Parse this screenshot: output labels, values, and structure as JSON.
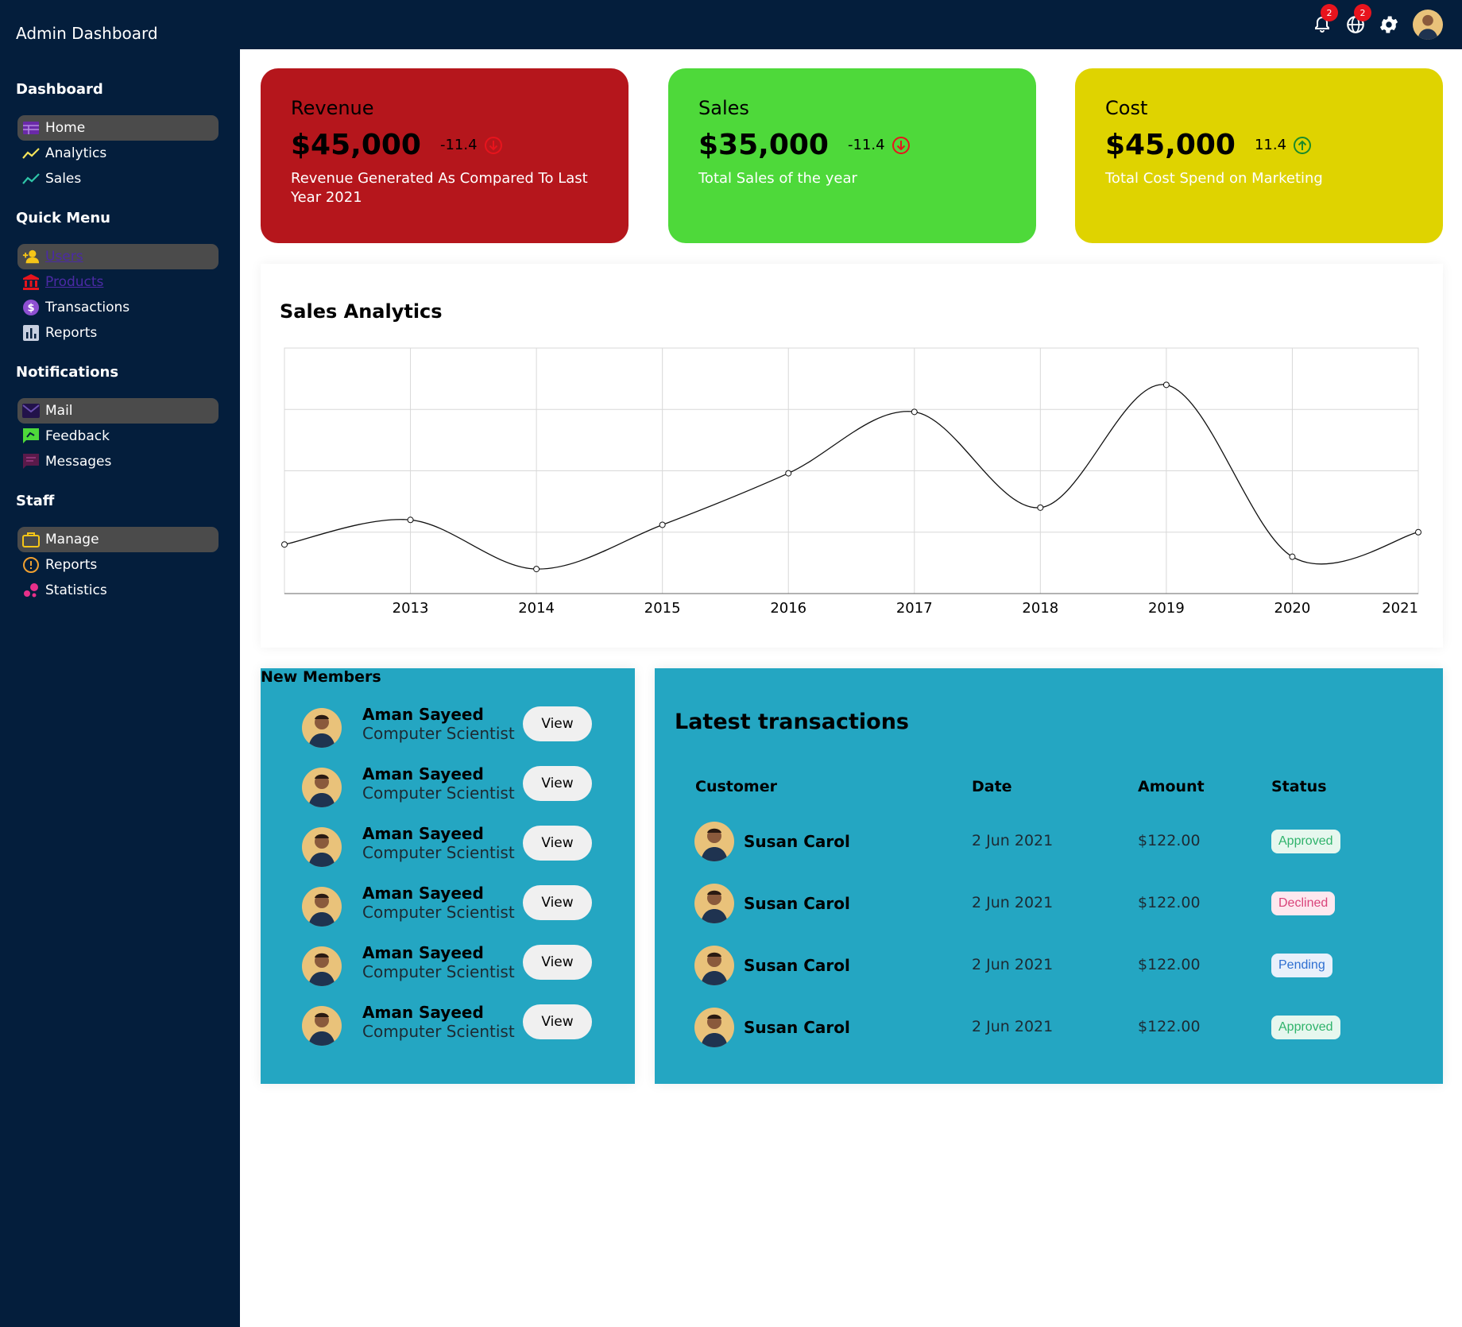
{
  "app": {
    "title": "Admin Dashboard"
  },
  "topbar": {
    "notifications": {
      "icon": "bell-icon",
      "badge": "2"
    },
    "language": {
      "icon": "globe-icon",
      "badge": "2"
    },
    "settings": {
      "icon": "gear-icon"
    },
    "avatar": {
      "icon": "avatar"
    }
  },
  "sidebar": {
    "sections": [
      {
        "title": "Dashboard",
        "items": [
          {
            "label": "Home",
            "icon": "home-icon",
            "active": true
          },
          {
            "label": "Analytics",
            "icon": "trending-up-icon"
          },
          {
            "label": "Sales",
            "icon": "trending-up-icon"
          }
        ]
      },
      {
        "title": "Quick Menu",
        "items": [
          {
            "label": "Users",
            "icon": "person-add-icon",
            "active": true,
            "link": true
          },
          {
            "label": "Products",
            "icon": "bank-icon",
            "link": true
          },
          {
            "label": "Transactions",
            "icon": "dollar-circle-icon"
          },
          {
            "label": "Reports",
            "icon": "bar-chart-icon"
          }
        ]
      },
      {
        "title": "Notifications",
        "items": [
          {
            "label": "Mail",
            "icon": "mail-icon",
            "active": true
          },
          {
            "label": "Feedback",
            "icon": "feedback-icon"
          },
          {
            "label": "Messages",
            "icon": "message-icon"
          }
        ]
      },
      {
        "title": "Staff",
        "items": [
          {
            "label": "Manage",
            "icon": "briefcase-icon",
            "active": true
          },
          {
            "label": "Reports",
            "icon": "alert-circle-icon"
          },
          {
            "label": "Statistics",
            "icon": "bubble-chart-icon"
          }
        ]
      }
    ]
  },
  "cards": [
    {
      "title": "Revenue",
      "value": "$45,000",
      "delta": "-11.4",
      "trend": "down",
      "description": "Revenue Generated As Compared To Last Year 2021",
      "color": "#b5161c",
      "arrow_color": "#e8141d"
    },
    {
      "title": "Sales",
      "value": "$35,000",
      "delta": "-11.4",
      "trend": "down",
      "description": "Total Sales of the year",
      "color": "#4ed93a",
      "arrow_color": "#e8141d"
    },
    {
      "title": "Cost",
      "value": "$45,000",
      "delta": "11.4",
      "trend": "up",
      "description": "Total Cost Spend on Marketing",
      "color": "#dfd300",
      "arrow_color": "#1a8a2a"
    }
  ],
  "chart_data": {
    "type": "line",
    "title": "Sales Analytics",
    "xlabel": "",
    "ylabel": "",
    "x": [
      "2012",
      "2013",
      "2014",
      "2015",
      "2016",
      "2017",
      "2018",
      "2019",
      "2020",
      "2021"
    ],
    "x_ticks": [
      "2013",
      "2014",
      "2015",
      "2016",
      "2017",
      "2018",
      "2019",
      "2020",
      "2021"
    ],
    "values": [
      0.2,
      0.3,
      0.1,
      0.28,
      0.49,
      0.74,
      0.35,
      0.85,
      0.15,
      0.25
    ],
    "ylim": [
      0,
      1
    ],
    "y_gridlines": 4,
    "grid": true,
    "curve": "smooth"
  },
  "members": {
    "title": "New Members",
    "items": [
      {
        "name": "Aman Sayeed",
        "job": "Computer Scientist",
        "button": "View"
      },
      {
        "name": "Aman Sayeed",
        "job": "Computer Scientist",
        "button": "View"
      },
      {
        "name": "Aman Sayeed",
        "job": "Computer Scientist",
        "button": "View"
      },
      {
        "name": "Aman Sayeed",
        "job": "Computer Scientist",
        "button": "View"
      },
      {
        "name": "Aman Sayeed",
        "job": "Computer Scientist",
        "button": "View"
      },
      {
        "name": "Aman Sayeed",
        "job": "Computer Scientist",
        "button": "View"
      }
    ]
  },
  "transactions": {
    "title": "Latest transactions",
    "headers": [
      "Customer",
      "Date",
      "Amount",
      "Status"
    ],
    "rows": [
      {
        "customer": "Susan Carol",
        "date": "2 Jun 2021",
        "amount": "$122.00",
        "status": "Approved",
        "status_bg": "#e6f7ee",
        "status_fg": "#2fb36b"
      },
      {
        "customer": "Susan Carol",
        "date": "2 Jun 2021",
        "amount": "$122.00",
        "status": "Declined",
        "status_bg": "#fde8ef",
        "status_fg": "#d9437a"
      },
      {
        "customer": "Susan Carol",
        "date": "2 Jun 2021",
        "amount": "$122.00",
        "status": "Pending",
        "status_bg": "#e8f0fb",
        "status_fg": "#2f6fd1"
      },
      {
        "customer": "Susan Carol",
        "date": "2 Jun 2021",
        "amount": "$122.00",
        "status": "Approved",
        "status_bg": "#e6f7ee",
        "status_fg": "#2fb36b"
      }
    ]
  }
}
